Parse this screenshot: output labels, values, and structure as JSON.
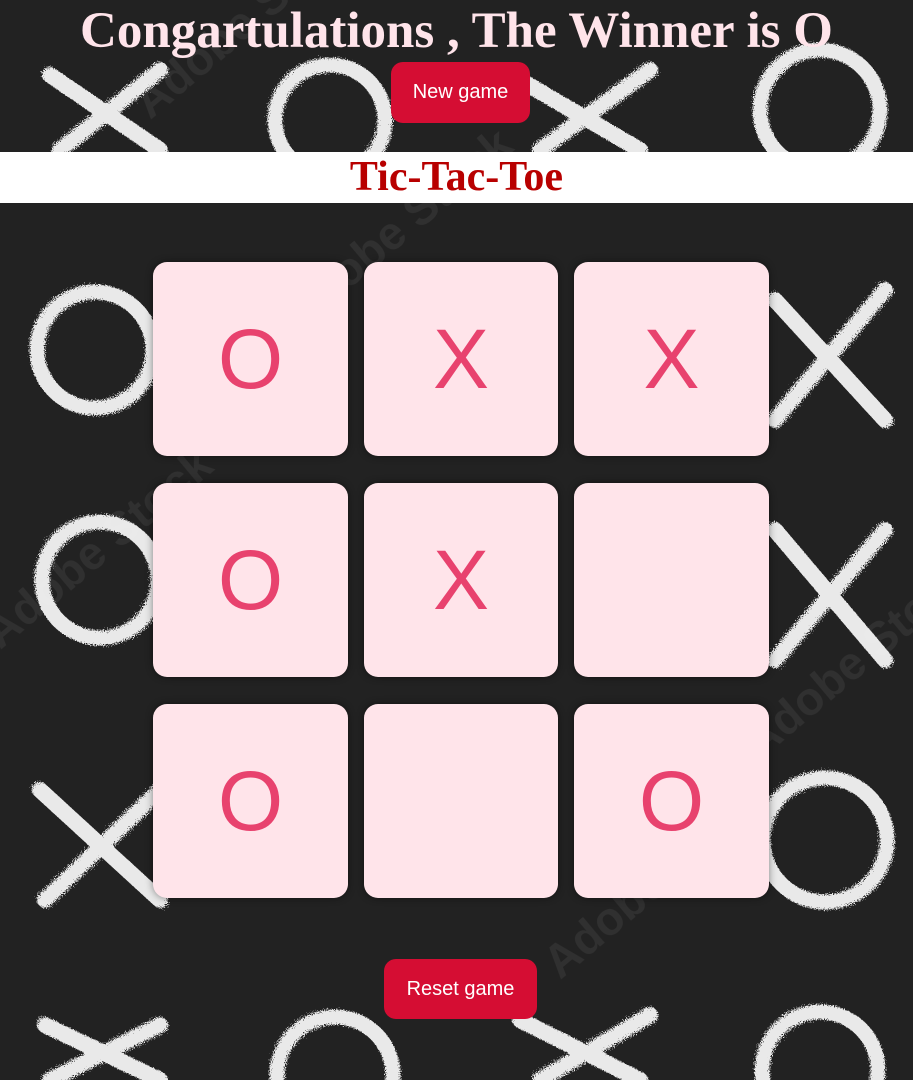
{
  "header": {
    "winner_message": "Congartulations , The Winner is O",
    "new_game_label": "New game"
  },
  "title": "Tic-Tac-Toe",
  "board": {
    "cells": [
      "O",
      "X",
      "X",
      "O",
      "X",
      "",
      "O",
      "",
      "O"
    ]
  },
  "footer": {
    "reset_label": "Reset game"
  },
  "background_watermark": "Adobe Stock",
  "colors": {
    "page_background": "#222222",
    "cell_background": "#ffe4ea",
    "mark_color": "#e8426e",
    "button_background": "#d50d33",
    "title_color": "#b80000",
    "winner_text_color": "#ffe4ea"
  }
}
